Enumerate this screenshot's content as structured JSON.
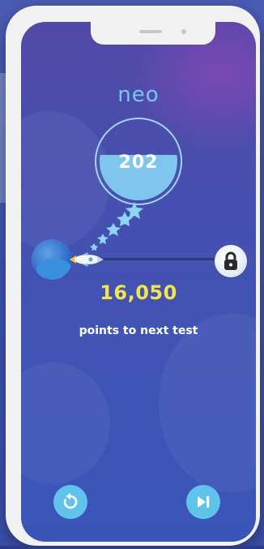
{
  "app": {
    "logo_text": "neo"
  },
  "progress": {
    "score": "202",
    "points_remaining": "16,050",
    "points_label": "points to next test"
  },
  "actions": {
    "retry_icon": "retry-icon",
    "skip_icon": "skip-next-icon"
  },
  "colors": {
    "background": "#3f55b6",
    "accent_yellow": "#f4e44a",
    "accent_cyan": "#5fc3ec"
  }
}
